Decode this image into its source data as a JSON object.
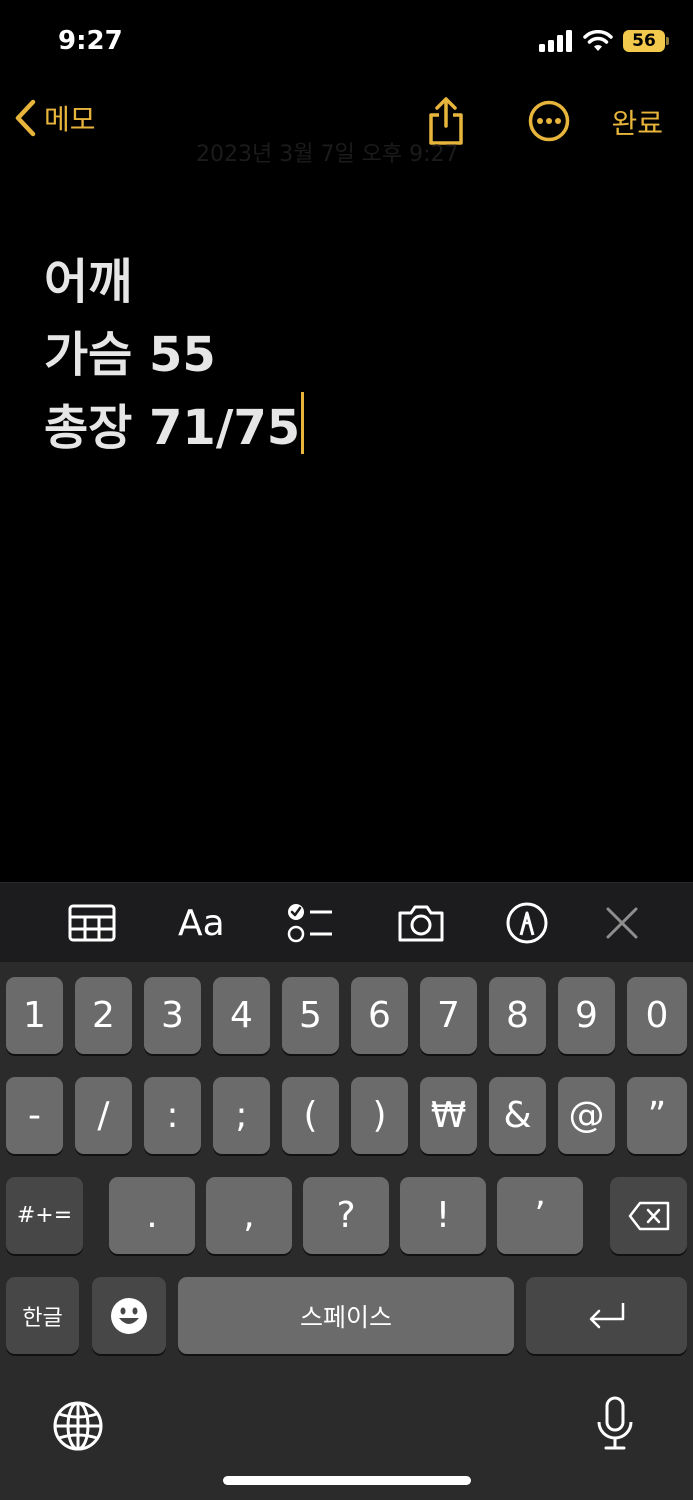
{
  "status": {
    "time": "9:27",
    "battery": "56"
  },
  "nav": {
    "back_label": "메모",
    "done_label": "완료",
    "ghost_date": "2023년 3월 7일 오후 9:27"
  },
  "note": {
    "lines": [
      "어깨",
      "가슴 55",
      "총장 71/75"
    ]
  },
  "toolbar": {
    "format_label": "Aa"
  },
  "keyboard": {
    "row1": [
      "1",
      "2",
      "3",
      "4",
      "5",
      "6",
      "7",
      "8",
      "9",
      "0"
    ],
    "row2": [
      "-",
      "/",
      ":",
      ";",
      "(",
      ")",
      "₩",
      "&",
      "@",
      "”"
    ],
    "row3": {
      "mode": "#+=",
      "keys": [
        ".",
        ",",
        "?",
        "!",
        "’"
      ]
    },
    "row4": {
      "lang": "한글",
      "space": "스페이스"
    }
  },
  "colors": {
    "accent": "#e8b53c",
    "background": "#000000",
    "key": "#6b6b6b",
    "key_dark": "#474747"
  }
}
